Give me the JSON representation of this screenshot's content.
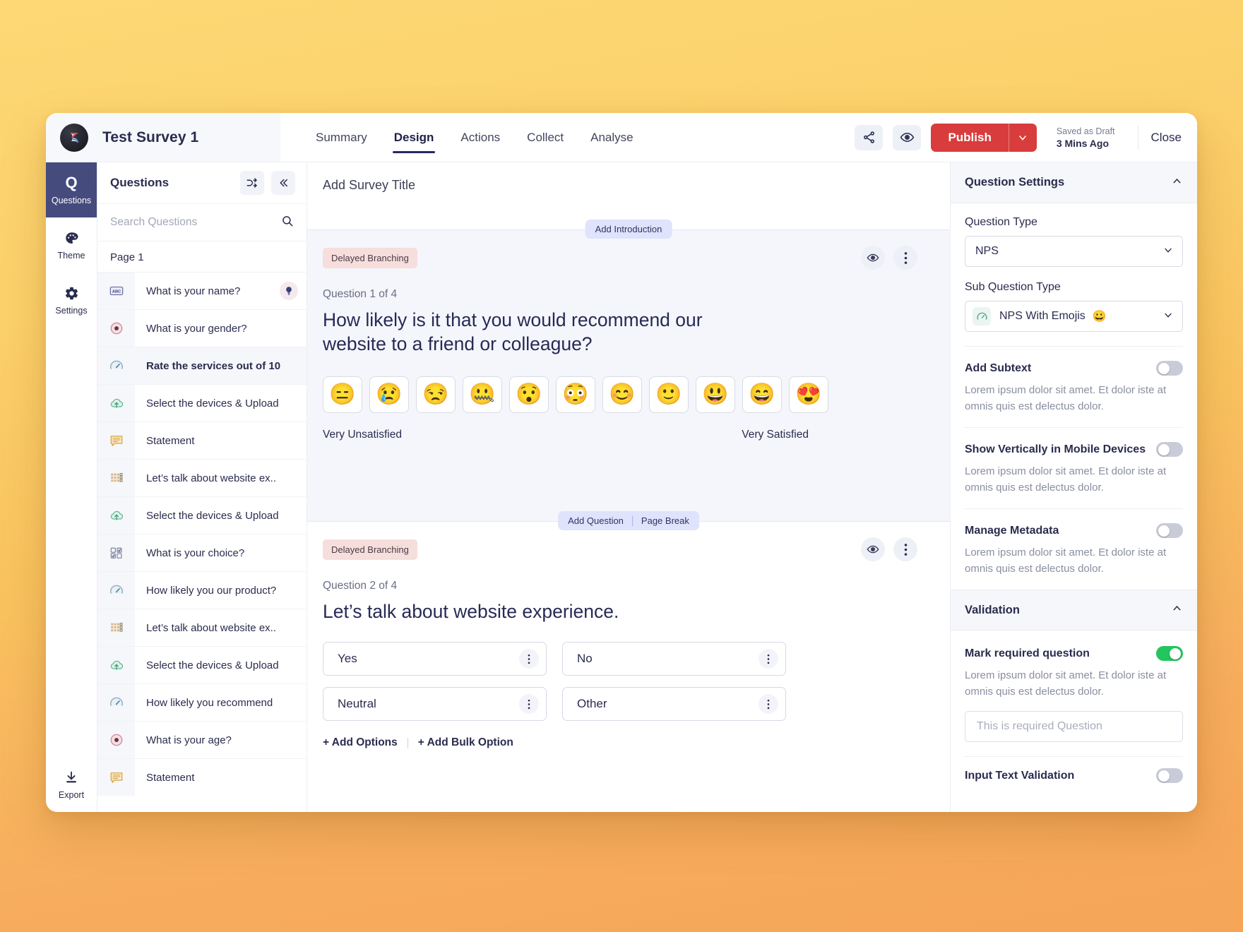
{
  "topbar": {
    "survey_title": "Test Survey 1",
    "tabs": [
      {
        "label": "Summary",
        "active": false
      },
      {
        "label": "Design",
        "active": true
      },
      {
        "label": "Actions",
        "active": false
      },
      {
        "label": "Collect",
        "active": false
      },
      {
        "label": "Analyse",
        "active": false
      }
    ],
    "share_icon": "share-icon",
    "preview_icon": "eye-icon",
    "publish_label": "Publish",
    "publish_caret_icon": "chevron-down-icon",
    "saved_status": "Saved as Draft",
    "saved_time": "3 Mins Ago",
    "close_label": "Close",
    "publish_color": "#d93c3c"
  },
  "rail": {
    "items": [
      {
        "label": "Questions",
        "icon": "question-letter-icon",
        "glyph": "Q",
        "active": true
      },
      {
        "label": "Theme",
        "icon": "palette-icon",
        "glyph": "🎨",
        "active": false
      },
      {
        "label": "Settings",
        "icon": "gear-icon",
        "glyph": "⚙",
        "active": false
      }
    ],
    "export": {
      "label": "Export",
      "icon": "download-icon",
      "glyph": "⬇"
    }
  },
  "questions_panel": {
    "title": "Questions",
    "shuffle_icon": "shuffle-icon",
    "collapse_icon": "chevron-double-left-icon",
    "search_placeholder": "Search Questions",
    "search_value": "",
    "search_icon": "search-icon",
    "page_label": "Page 1",
    "items": [
      {
        "label": "What is your name?",
        "icon": "abc-text-icon",
        "glyph": "ABC",
        "selected": false,
        "has_bulb": true
      },
      {
        "label": "What is your gender?",
        "icon": "radio-button-icon",
        "glyph": "◉",
        "selected": false,
        "has_bulb": false
      },
      {
        "label": "Rate the services out of 10",
        "icon": "gauge-icon",
        "glyph": "◔",
        "selected": true,
        "has_bulb": false
      },
      {
        "label": "Select the devices & Upload",
        "icon": "cloud-upload-icon",
        "glyph": "☁",
        "selected": false,
        "has_bulb": false
      },
      {
        "label": "Statement",
        "icon": "statement-icon",
        "glyph": "💬",
        "selected": false,
        "has_bulb": false
      },
      {
        "label": "Let’s talk about website ex..",
        "icon": "matrix-grid-icon",
        "glyph": "▦",
        "selected": false,
        "has_bulb": false
      },
      {
        "label": "Select the devices & Upload",
        "icon": "cloud-upload-icon",
        "glyph": "☁",
        "selected": false,
        "has_bulb": false
      },
      {
        "label": "What is your choice?",
        "icon": "checkbox-grid-icon",
        "glyph": "☑",
        "selected": false,
        "has_bulb": false
      },
      {
        "label": "How likely you our product?",
        "icon": "gauge-icon",
        "glyph": "◔",
        "selected": false,
        "has_bulb": false
      },
      {
        "label": "Let’s talk about website ex..",
        "icon": "matrix-grid-icon",
        "glyph": "▦",
        "selected": false,
        "has_bulb": false
      },
      {
        "label": "Select the devices & Upload",
        "icon": "cloud-upload-icon",
        "glyph": "☁",
        "selected": false,
        "has_bulb": false
      },
      {
        "label": "How likely you recommend",
        "icon": "gauge-icon",
        "glyph": "◔",
        "selected": false,
        "has_bulb": false
      },
      {
        "label": "What is your age?",
        "icon": "radio-button-icon",
        "glyph": "◉",
        "selected": false,
        "has_bulb": false
      },
      {
        "label": "Statement",
        "icon": "statement-icon",
        "glyph": "💬",
        "selected": false,
        "has_bulb": false
      }
    ]
  },
  "canvas": {
    "survey_title_placeholder": "Add Survey Title",
    "add_introduction": "Add Introduction",
    "add_question": "Add Question",
    "page_break": "Page Break",
    "question1": {
      "badge": "Delayed Branching",
      "counter": "Question 1 of 4",
      "title": "How likely is it that you would recommend our website to a friend or colleague?",
      "preview_icon": "eye-icon",
      "more_icon": "kebab-menu-icon",
      "emojis": [
        "😑",
        "😢",
        "😒",
        "🤐",
        "😯",
        "😳",
        "😊",
        "🙂",
        "😃",
        "😄",
        "😍"
      ],
      "label_low": "Very Unsatisfied",
      "label_high": "Very Satisfied"
    },
    "question2": {
      "badge": "Delayed Branching",
      "counter": "Question 2 of 4",
      "title": "Let’s talk about website experience.",
      "preview_icon": "eye-icon",
      "more_icon": "kebab-menu-icon",
      "options": [
        "Yes",
        "No",
        "Neutral",
        "Other"
      ],
      "add_options": "+ Add Options",
      "add_bulk_option": "+ Add Bulk Option"
    }
  },
  "settings": {
    "question_settings": {
      "title": "Question Settings",
      "collapse_icon": "chevron-up-icon",
      "question_type_label": "Question Type",
      "question_type_value": "NPS",
      "sub_question_type_label": "Sub Question Type",
      "sub_question_type_value": "NPS With Emojis",
      "sub_question_type_emoji": "😀",
      "sub_question_type_icon": "gauge-icon",
      "rows": [
        {
          "label": "Add Subtext",
          "on": false,
          "helper": "Lorem ipsum dolor sit amet. Et dolor iste at omnis quis est delectus dolor."
        },
        {
          "label": "Show Vertically in Mobile Devices",
          "on": false,
          "helper": "Lorem ipsum dolor sit amet. Et dolor iste at omnis quis est delectus dolor."
        },
        {
          "label": "Manage Metadata",
          "on": false,
          "helper": "Lorem ipsum dolor sit amet. Et dolor iste at omnis quis est delectus dolor."
        }
      ]
    },
    "validation": {
      "title": "Validation",
      "collapse_icon": "chevron-up-icon",
      "mark_required_label": "Mark required question",
      "mark_required_on": true,
      "mark_required_helper": "Lorem ipsum dolor sit amet. Et dolor iste at omnis quis est delectus dolor.",
      "required_placeholder": "This is required Question",
      "required_value": "",
      "input_text_validation_label": "Input Text Validation",
      "input_text_validation_on": false,
      "toggle_on_color": "#22c55e"
    }
  }
}
